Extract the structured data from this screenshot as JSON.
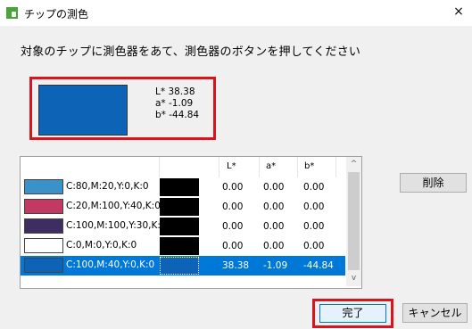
{
  "window": {
    "title": "チップの測色",
    "close_glyph": "×"
  },
  "instruction": "対象のチップに測色器をあて、測色器のボタンを押してください",
  "preview": {
    "swatch_color": "#0d63b6",
    "L": "L* 38.38",
    "a": "a* -1.09",
    "b": "b* -44.84"
  },
  "table": {
    "headers": {
      "L": "L*",
      "a": "a*",
      "b": "b*"
    },
    "rows": [
      {
        "color": "#3b92c8",
        "cmyk": "C:80,M:20,Y:0,K:0",
        "L": "0.00",
        "a": "0.00",
        "b": "0.00",
        "selected": false
      },
      {
        "color": "#c23a64",
        "cmyk": "C:20,M:100,Y:40,K:0",
        "L": "0.00",
        "a": "0.00",
        "b": "0.00",
        "selected": false
      },
      {
        "color": "#3d2d61",
        "cmyk": "C:100,M:100,Y:30,K:0",
        "L": "0.00",
        "a": "0.00",
        "b": "0.00",
        "selected": false
      },
      {
        "color": "#ffffff",
        "cmyk": "C:0,M:0,Y:0,K:0",
        "L": "0.00",
        "a": "0.00",
        "b": "0.00",
        "selected": false
      },
      {
        "color": "#0d63b6",
        "cmyk": "C:100,M:40,Y:0,K:0",
        "L": "38.38",
        "a": "-1.09",
        "b": "-44.84",
        "selected": true
      }
    ]
  },
  "scroll": {
    "up": "^",
    "down": "v"
  },
  "buttons": {
    "delete": "削除",
    "done": "完了",
    "cancel": "キャンセル"
  }
}
